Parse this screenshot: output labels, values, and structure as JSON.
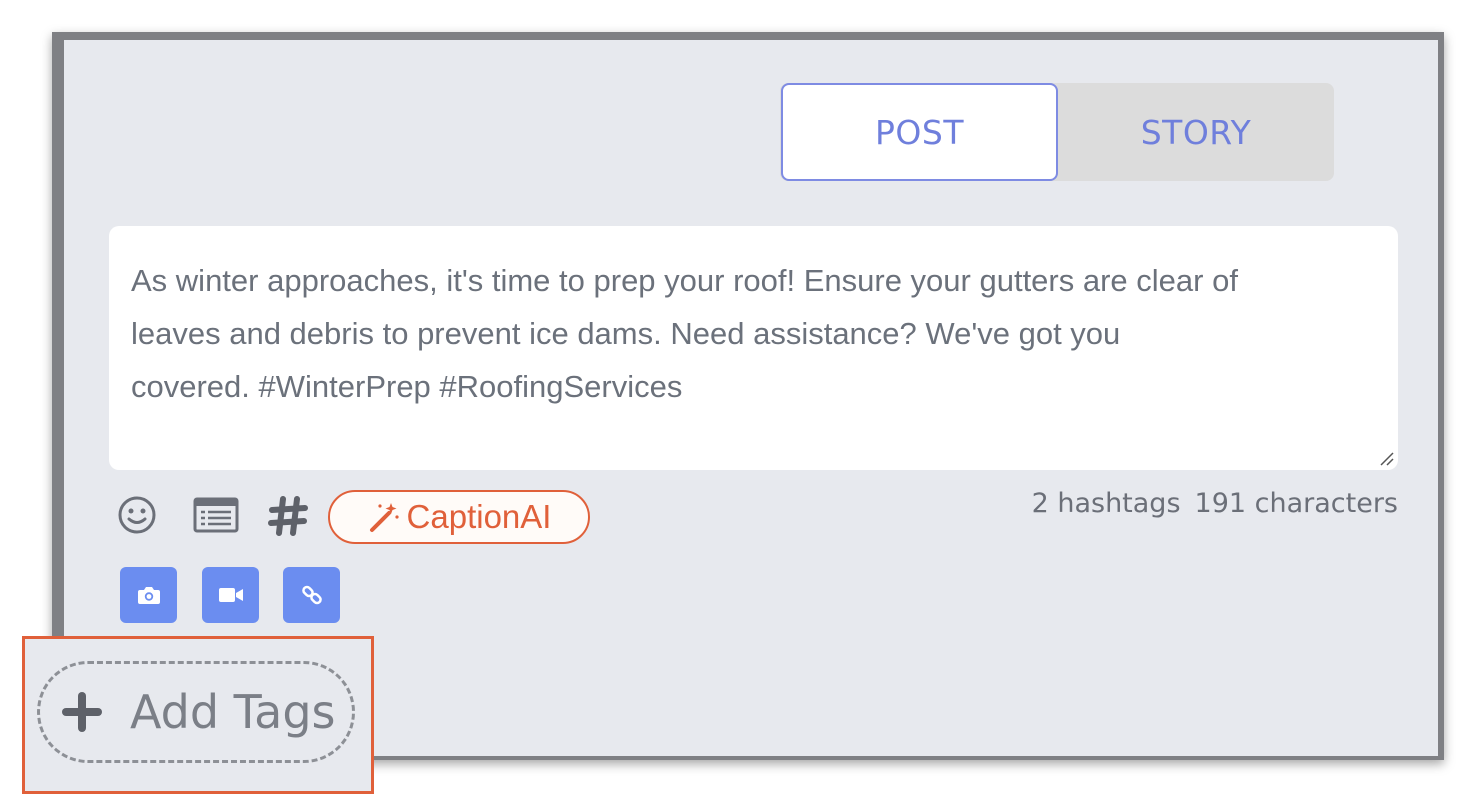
{
  "tabs": {
    "post_label": "POST",
    "story_label": "STORY",
    "active": "POST"
  },
  "caption": {
    "text": "As winter approaches, it's time to prep your roof! Ensure your gutters are clear of\nleaves and debris to prevent ice dams. Need assistance? We've got you\ncovered. #WinterPrep #RoofingServices"
  },
  "toolbar": {
    "icons": [
      "emoji-icon",
      "template-icon",
      "hashtag-icon"
    ],
    "caption_ai_label": "CaptionAI",
    "caption_ai_icon": "magic-wand-icon"
  },
  "stats": {
    "hashtags": "2 hashtags",
    "characters": "191 characters"
  },
  "media": {
    "buttons": [
      "camera-icon",
      "video-icon",
      "link-icon"
    ]
  },
  "tags": {
    "add_label": "Add Tags",
    "icon": "plus-icon"
  },
  "colors": {
    "accent": "#6f7fdc",
    "caption_ai": "#e0603a",
    "media_button": "#6b8df0",
    "highlight": "#e0603a"
  }
}
